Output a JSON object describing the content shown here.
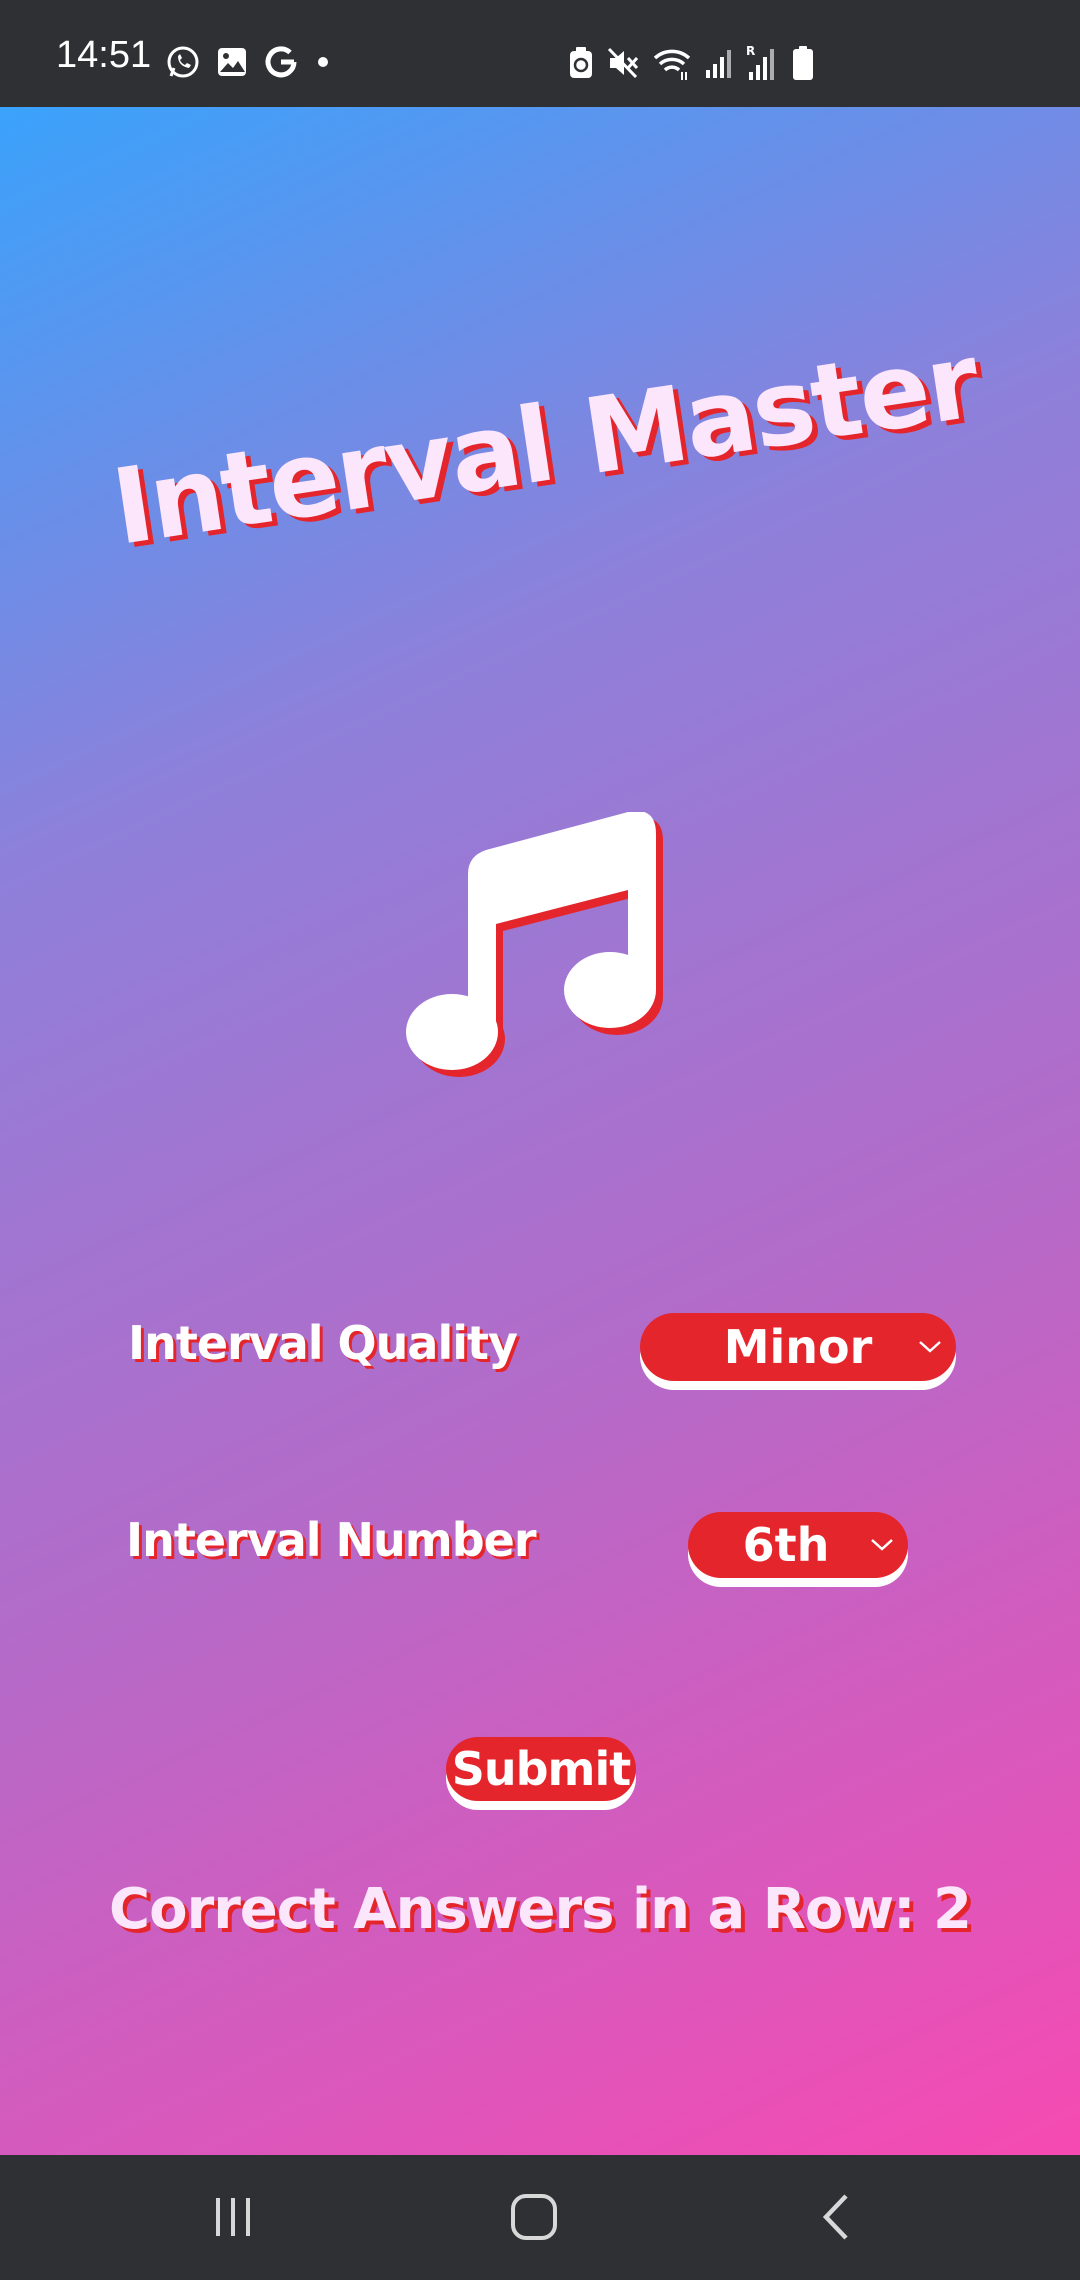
{
  "status_bar": {
    "time": "14:51",
    "notification_icons": [
      "whatsapp-icon",
      "gallery-icon",
      "google-icon",
      "more-notifications-dot-icon"
    ],
    "system_icons": [
      "battery-saver-icon",
      "mute-icon",
      "wifi-icon",
      "signal-icon",
      "roaming-signal-icon",
      "battery-icon"
    ]
  },
  "app": {
    "title": "Interval Master",
    "icon": "music-note-icon",
    "quality": {
      "label": "Interval Quality",
      "selected": "Minor"
    },
    "number": {
      "label": "Interval Number",
      "selected": "6th"
    },
    "submit_label": "Submit",
    "streak_text": "Correct Answers in a Row: 2",
    "colors": {
      "accent_red": "#e4262c",
      "gradient_start": "#3aa2fb",
      "gradient_end": "#f64ab2",
      "title_text": "#fbe6fb"
    }
  },
  "nav_bar": {
    "buttons": [
      "recent-apps-icon",
      "home-icon",
      "back-icon"
    ]
  }
}
